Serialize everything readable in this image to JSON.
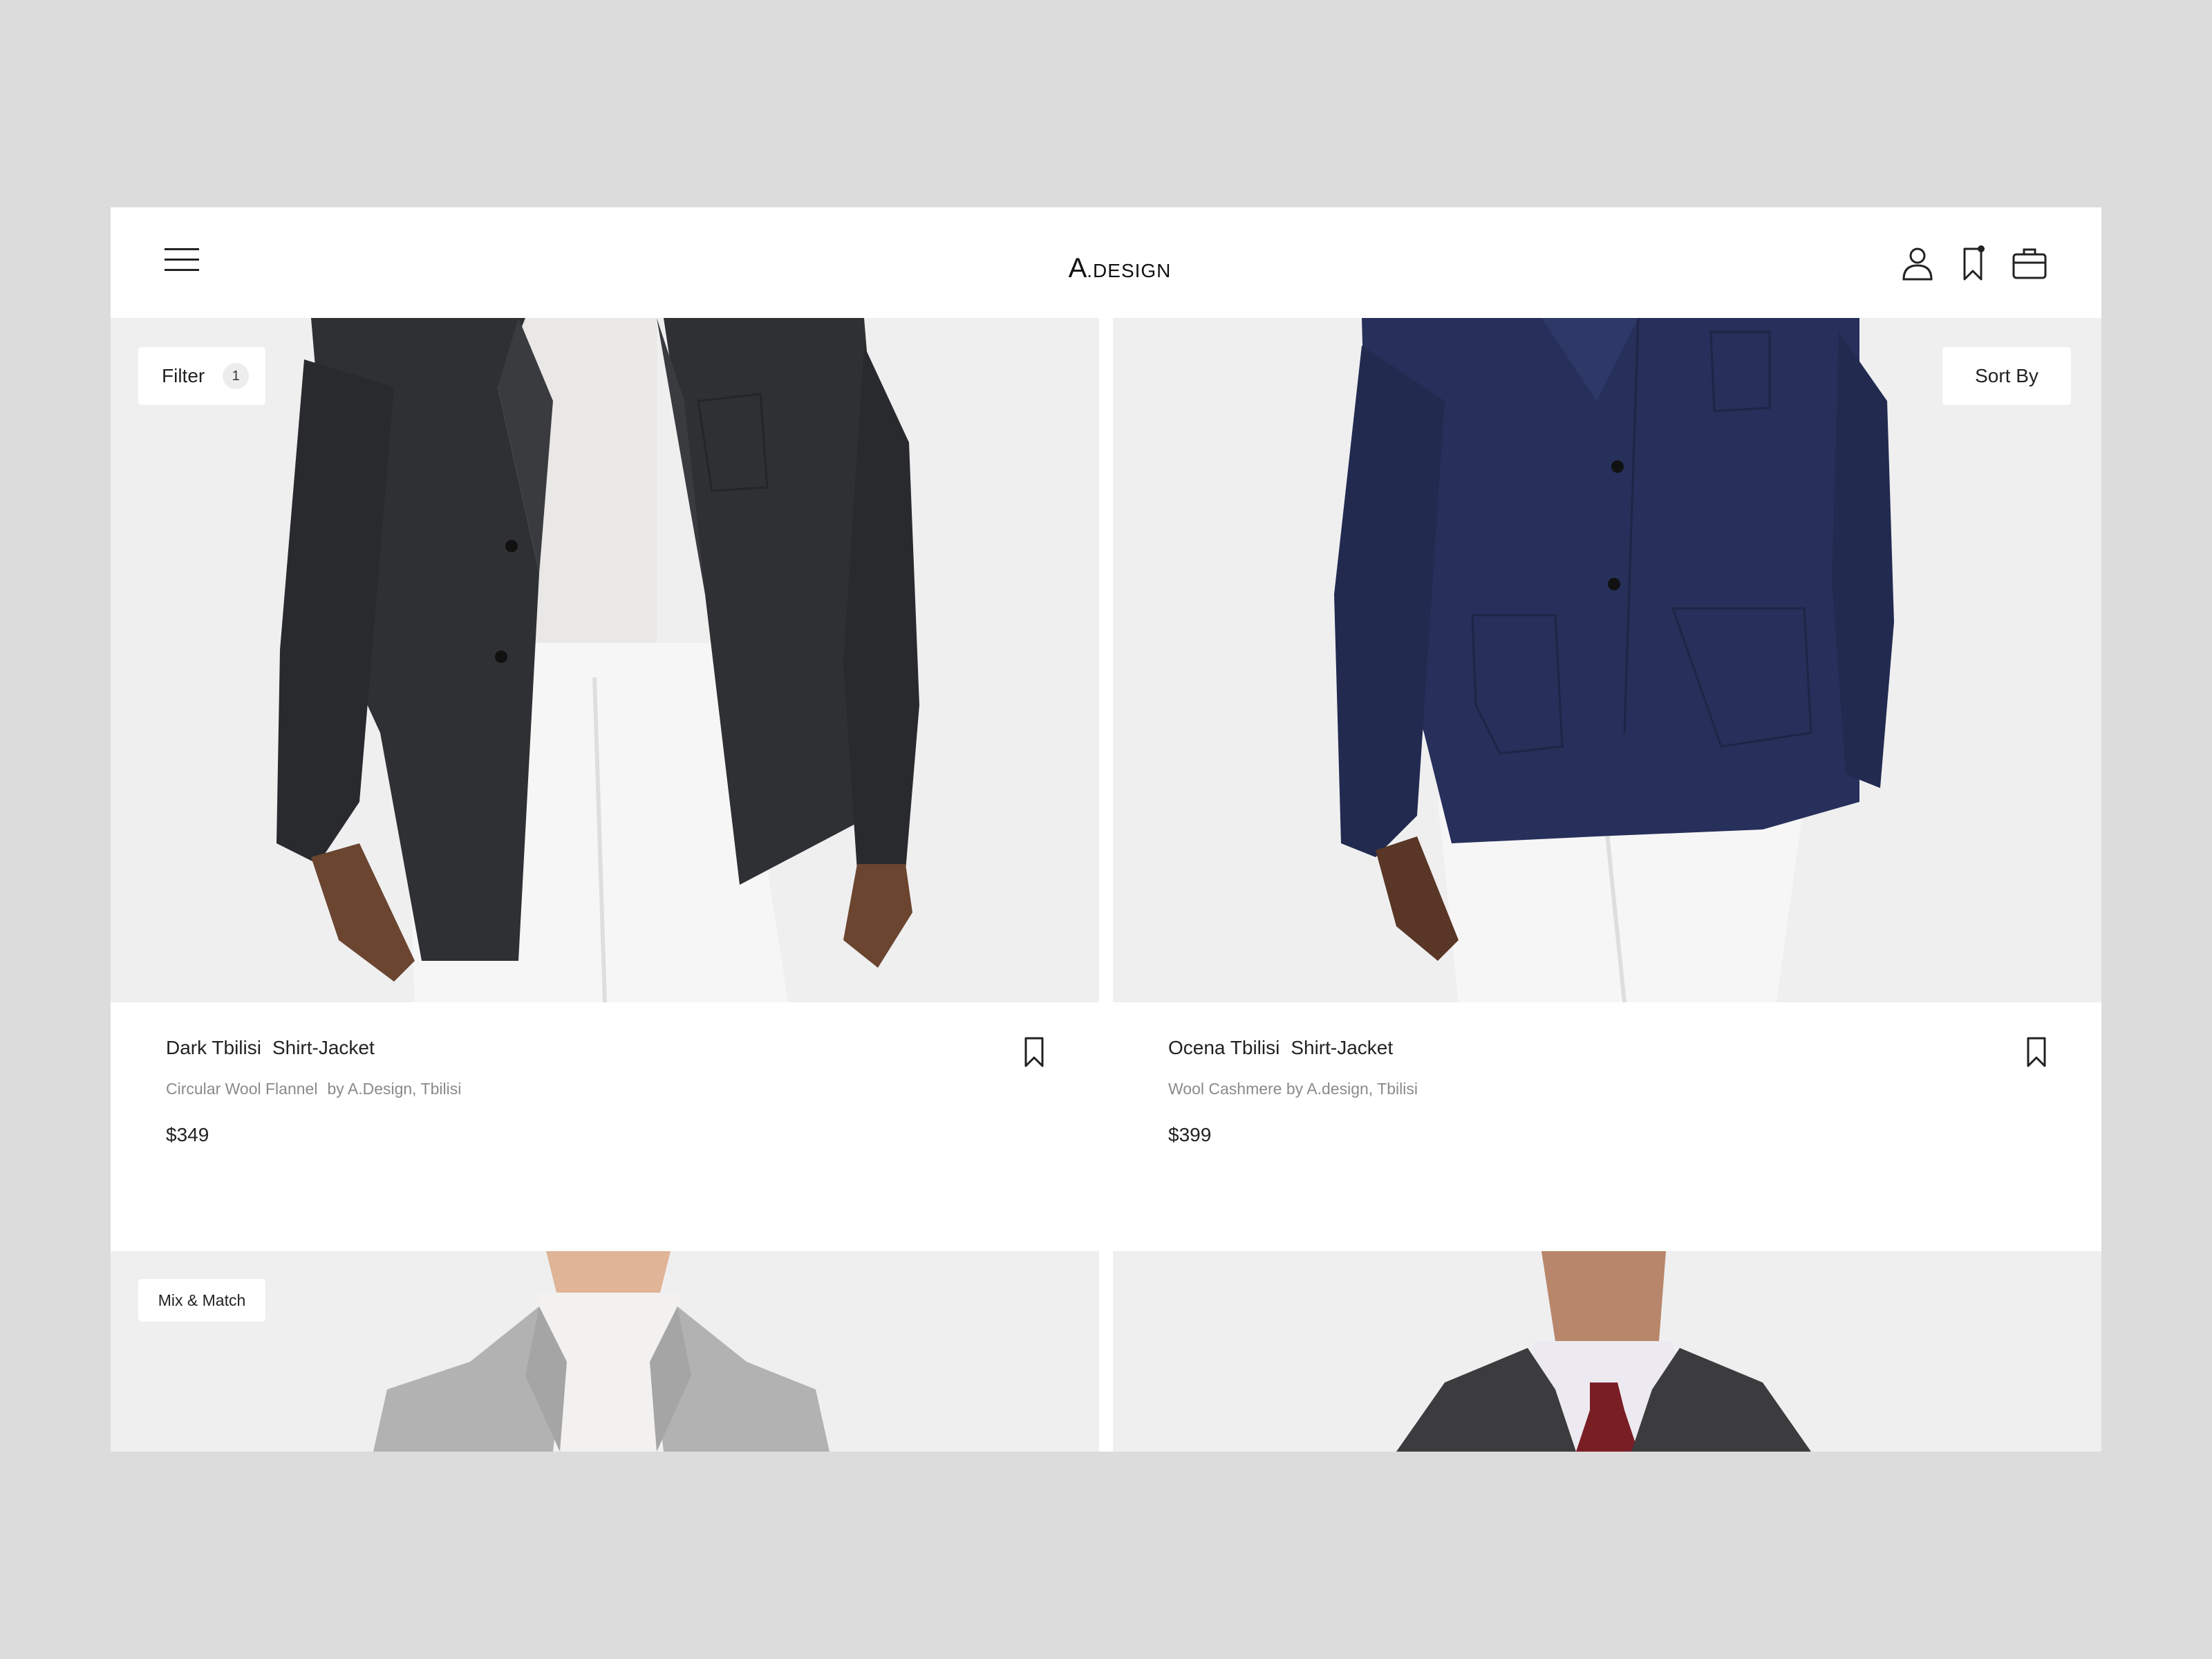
{
  "header": {
    "logo_letter": "A",
    "logo_word": ".DESIGN",
    "icons": [
      "menu-icon",
      "user-icon",
      "bookmark-icon",
      "bag-icon"
    ]
  },
  "filter": {
    "label": "Filter",
    "count": "1"
  },
  "sort": {
    "label": "Sort By"
  },
  "products": [
    {
      "name": "Dark Tbilisi",
      "type": "Shirt-Jacket",
      "material": "Circular Wool Flannel",
      "maker": "by A.Design, Tbilisi",
      "price": "$349",
      "jacket_color": "#2f3033"
    },
    {
      "name": "Ocena Tbilisi",
      "type": "Shirt-Jacket",
      "material": "Wool Cashmere by A.design, Tbilisi",
      "maker": "",
      "price": "$399",
      "jacket_color": "#27305a"
    }
  ],
  "mix_match": {
    "label": "Mix & Match"
  },
  "colors": {
    "background": "#dcdcdc",
    "image_bg": "#efeff0",
    "text": "#222222",
    "muted": "#8a8a8a"
  }
}
